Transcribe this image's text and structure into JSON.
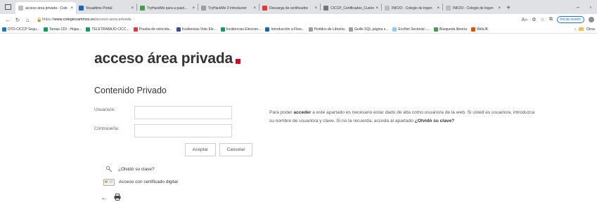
{
  "tabs": [
    {
      "label": "acceso área privada - Cole",
      "color": "#bdbdbd",
      "active": true
    },
    {
      "label": "Visualtime Portal",
      "color": "#1565c0"
    },
    {
      "label": "TryHackMe para a pasó...",
      "color": "#43a047"
    },
    {
      "label": "TryHackMe 3 Introductor",
      "color": "#9e9e9e"
    },
    {
      "label": "Descarga de certificados",
      "color": "#e53935"
    },
    {
      "label": "CICCP_Certificados_Custod",
      "color": "#757575"
    },
    {
      "label": "INICIO - Colegio de Ingen",
      "color": "#bdbdbd"
    },
    {
      "label": "INICIO - Colegio de Ingen",
      "color": "#bdbdbd"
    }
  ],
  "window_controls": {
    "new_tab": "+",
    "minimize": "–",
    "maximize": "▫"
  },
  "address": {
    "scheme": "https://",
    "domain": "www.colegiocaminos.es",
    "path": "/acceso-area-privada"
  },
  "toolbar": {
    "signin_label": "Iniciar sesión"
  },
  "bookmarks": [
    {
      "label": "OTD-CICCP Segu...",
      "color": "#1976d2"
    },
    {
      "label": "Tareas CDI - Hojas...",
      "color": "#0f9d58"
    },
    {
      "label": "TELETRABAJO CICC...",
      "color": "#0f9d58"
    },
    {
      "label": "Prueba de velocida...",
      "color": "#e53935"
    },
    {
      "label": "Incidencias Voto Ele...",
      "color": "#3949ab"
    },
    {
      "label": "Incidencias Eleccion...",
      "color": "#0f9d58"
    },
    {
      "label": "Introducción a Flow...",
      "color": "#1565c0"
    },
    {
      "label": "Pedidos de Librería",
      "color": "#9e9e9e"
    },
    {
      "label": "Guille SQL página s...",
      "color": "#9e9e9e"
    },
    {
      "label": "EcoNet Sectorial -...",
      "color": "#90caf9"
    },
    {
      "label": "Búsqueda librería",
      "color": "#43a047"
    },
    {
      "label": "WebJK",
      "color": "#e65100"
    }
  ],
  "bookmarks_more": "Otros",
  "page": {
    "title": "acceso área privada",
    "section": "Contenido Privado",
    "user_label": "Usuario/a:",
    "password_label": "Contraseña:",
    "accept": "Aceptar",
    "cancel": "Cancelar",
    "info_pre": "Para poder ",
    "info_bold": "acceder",
    "info_mid": " a este apartado es necesario estar dado de alta como usuario/a de la web. Si usted es usuario/a, introduzca su nombre de usuario/a y clave. Si no la recuerda, acceda al apartado ",
    "info_link": "¿Olvidó su clave?",
    "forgot": "¿Olvidó su clave?",
    "certificate": "Acceso con certificado digital"
  },
  "colors": {
    "brand_red": "#e3051b",
    "tab_bar": "#dfe1e5"
  }
}
